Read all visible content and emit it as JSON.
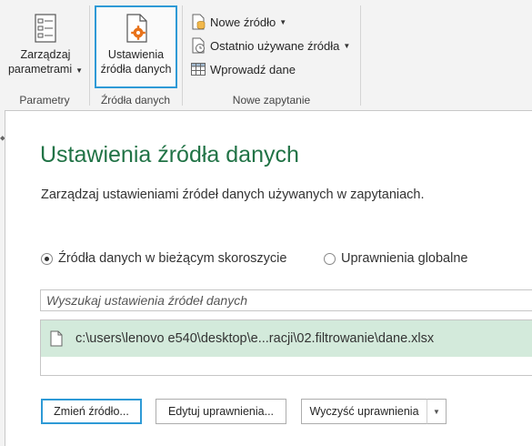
{
  "ribbon": {
    "params_group": {
      "button_line1": "Zarządzaj",
      "button_line2": "parametrami",
      "label": "Parametry"
    },
    "source_group": {
      "button_line1": "Ustawienia",
      "button_line2": "źródła danych",
      "label": "Źródła danych"
    },
    "query_group": {
      "new_source": "Nowe źródło",
      "recent_sources": "Ostatnio używane źródła",
      "enter_data": "Wprowadź dane",
      "label": "Nowe zapytanie"
    }
  },
  "dialog": {
    "title": "Ustawienia źródła danych",
    "description": "Zarządzaj ustawieniami źródeł danych używanych w zapytaniach.",
    "radio_current": "Źródła danych w bieżącym skoroszycie",
    "radio_global": "Uprawnienia globalne",
    "search_placeholder": "Wyszukaj ustawienia źródeł danych",
    "sources": [
      {
        "path": "c:\\users\\lenovo e540\\desktop\\e...racji\\02.filtrowanie\\dane.xlsx"
      }
    ],
    "buttons": {
      "change_source": "Zmień źródło...",
      "edit_permissions": "Edytuj uprawnienia...",
      "clear_permissions": "Wyczyść uprawnienia"
    }
  },
  "colors": {
    "title_green": "#217346",
    "selection_green": "#d3eadb",
    "focus_blue": "#2e9ad6",
    "gear_orange": "#e8731b"
  },
  "icons": {
    "params": "parameters-list-icon",
    "source_settings": "document-gear-icon",
    "new_source": "database-document-icon",
    "recent_sources": "document-clock-icon",
    "enter_data": "table-grid-icon",
    "file": "file-icon"
  }
}
